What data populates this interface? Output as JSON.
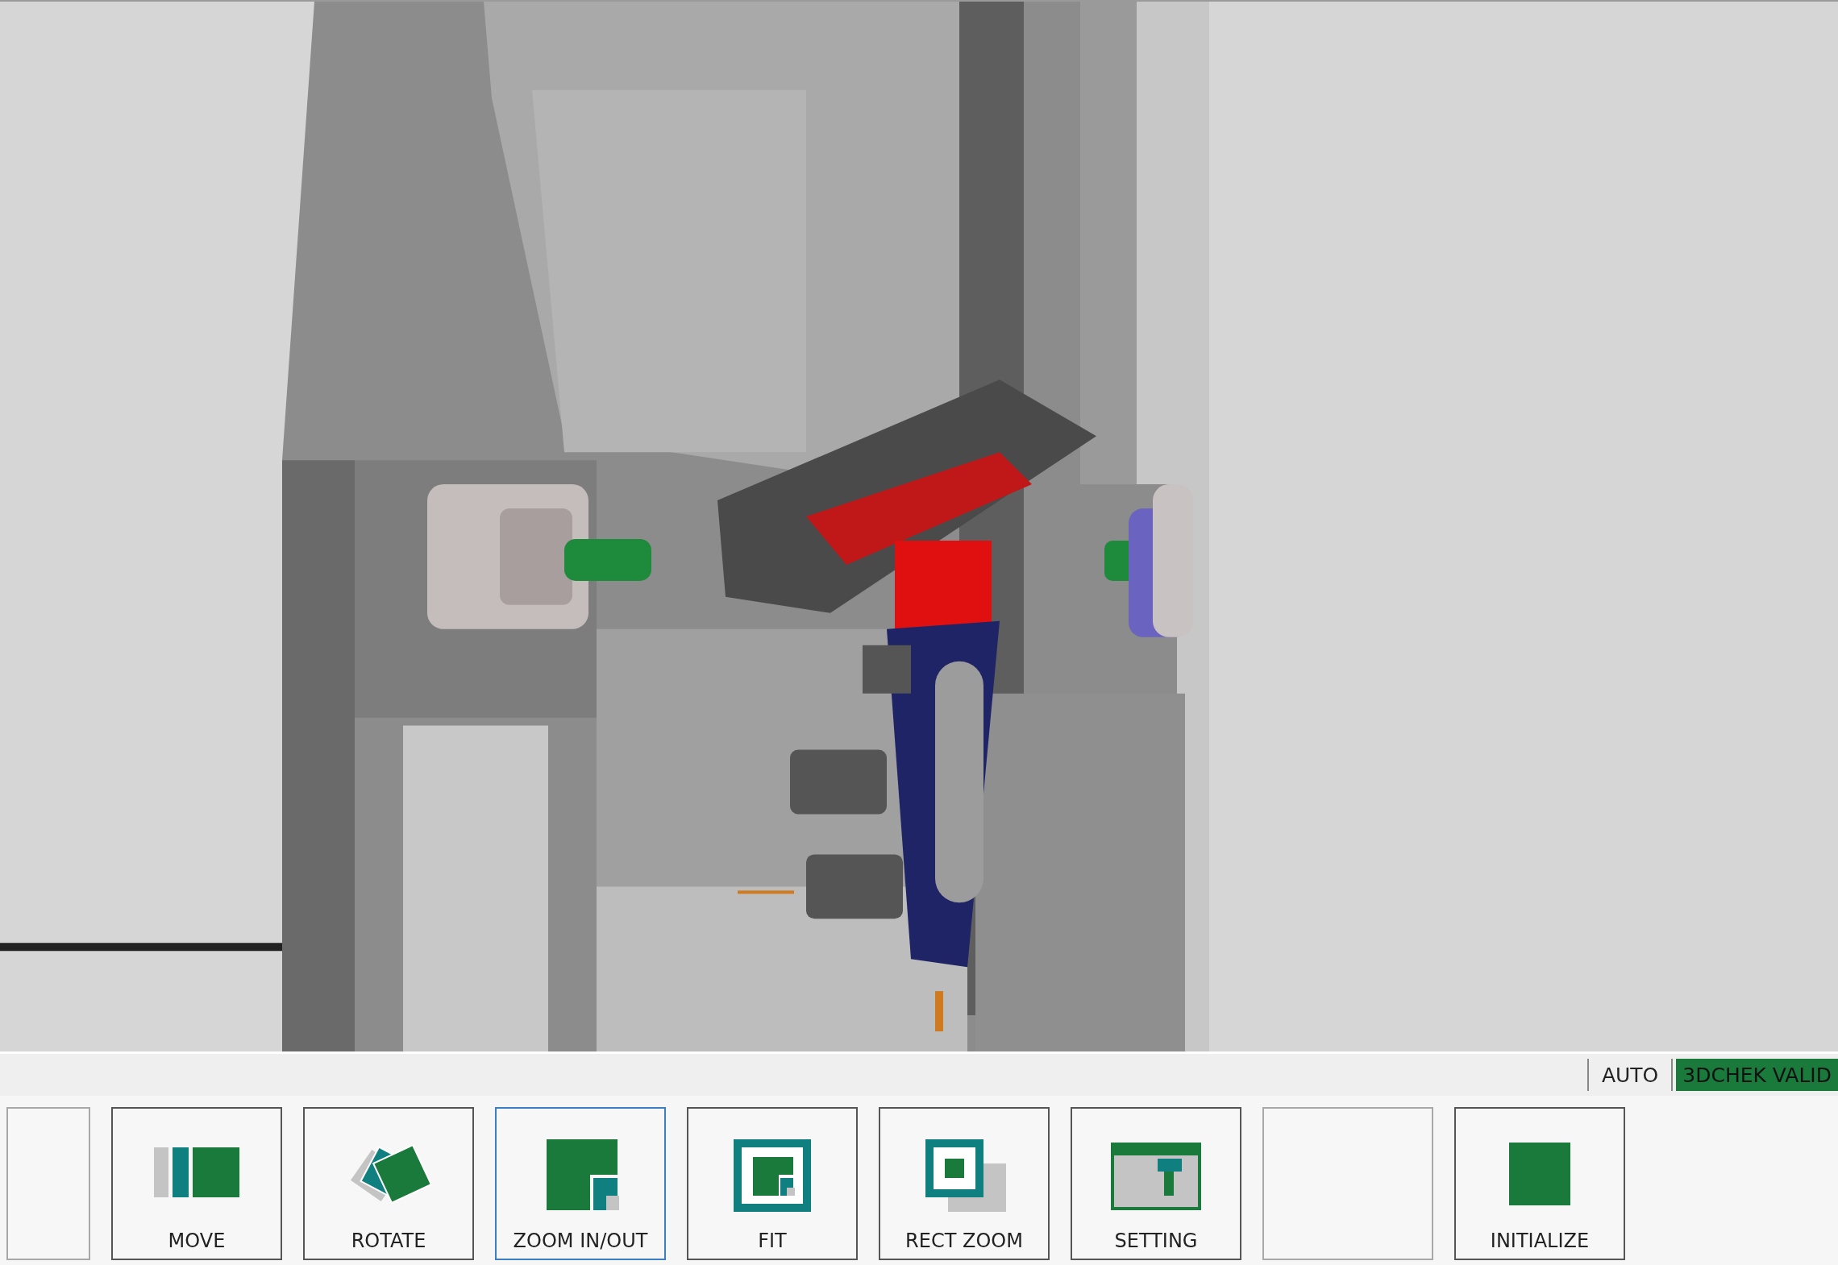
{
  "viewport": {
    "kind": "machine-render"
  },
  "status_bar": {
    "mode": "AUTO",
    "check": {
      "text": "3DCHEK VALID",
      "ok": true
    }
  },
  "buttons": [
    {
      "kind": "blank",
      "selected": false,
      "disabled": true
    },
    {
      "kind": "move",
      "label": "MOVE",
      "selected": false,
      "disabled": false
    },
    {
      "kind": "rotate",
      "label": "ROTATE",
      "selected": false,
      "disabled": false
    },
    {
      "kind": "zoom",
      "label": "ZOOM IN/OUT",
      "selected": true,
      "disabled": false
    },
    {
      "kind": "fit",
      "label": "FIT",
      "selected": false,
      "disabled": false
    },
    {
      "kind": "rect-zoom",
      "label": "RECT ZOOM",
      "selected": false,
      "disabled": false
    },
    {
      "kind": "setting",
      "label": "SETTING",
      "selected": false,
      "disabled": false
    },
    {
      "kind": "blank",
      "selected": false,
      "disabled": true
    },
    {
      "kind": "initialize",
      "label": "INITIALIZE",
      "selected": false,
      "disabled": false
    }
  ]
}
